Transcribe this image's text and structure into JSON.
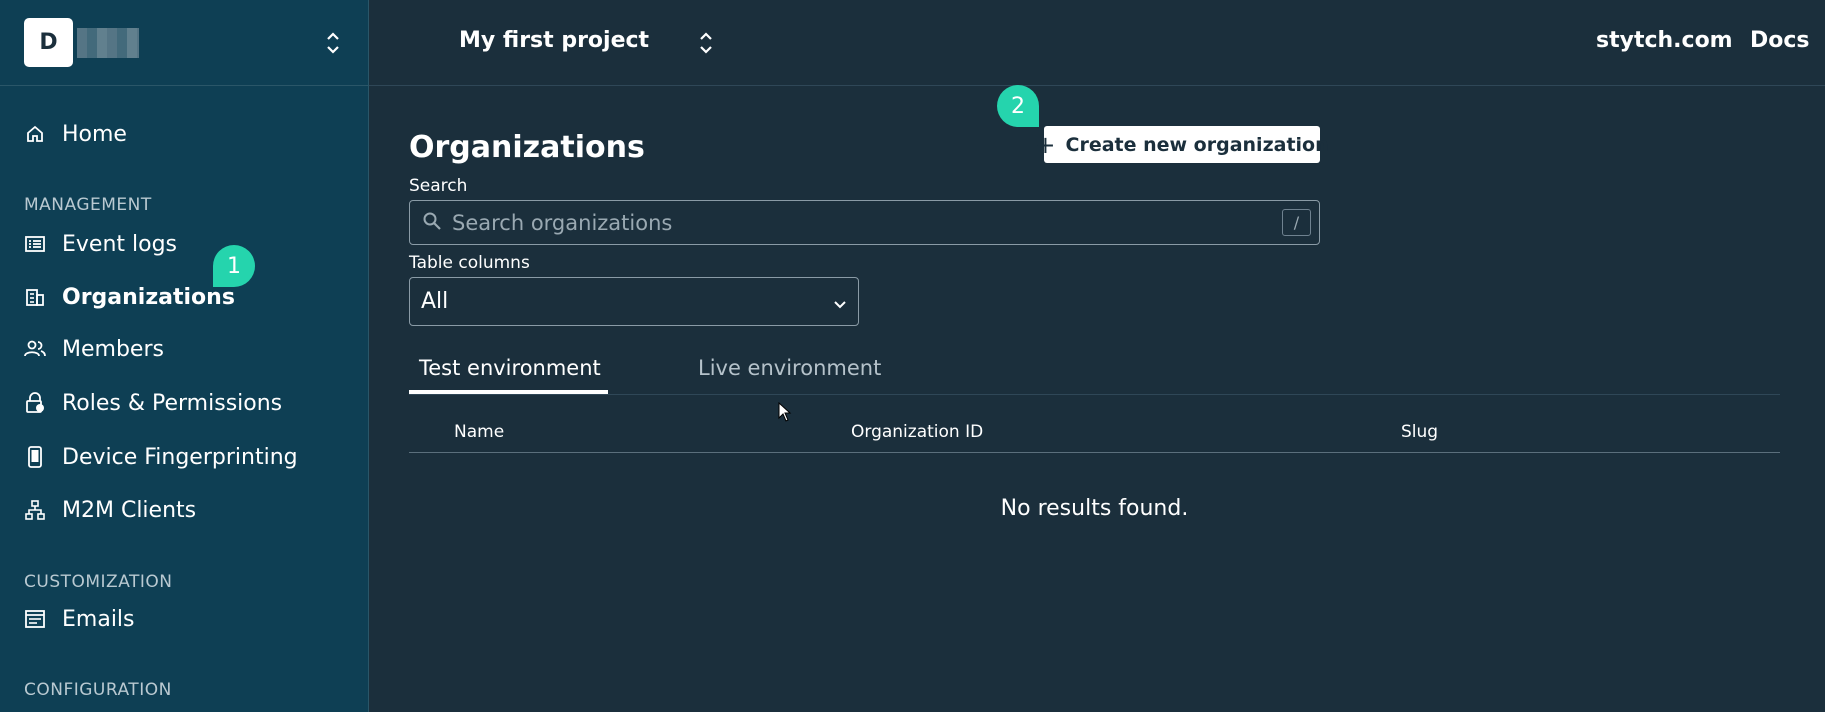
{
  "workspace": {
    "initial": "D"
  },
  "project": {
    "name": "My first project"
  },
  "top_links": {
    "site": "stytch.com",
    "docs": "Docs"
  },
  "sidebar": {
    "home": "Home",
    "sections": {
      "management": "MANAGEMENT",
      "customization": "CUSTOMIZATION",
      "configuration": "CONFIGURATION"
    },
    "items": {
      "event_logs": "Event logs",
      "organizations": "Organizations",
      "members": "Members",
      "roles": "Roles & Permissions",
      "device": "Device Fingerprinting",
      "m2m": "M2M Clients",
      "emails": "Emails"
    },
    "active": "organizations"
  },
  "badges": {
    "one": "1",
    "two": "2"
  },
  "page": {
    "title": "Organizations",
    "create_button": "Create new organization",
    "search_label": "Search",
    "search_placeholder": "Search organizations",
    "search_shortcut": "/",
    "columns_label": "Table columns",
    "columns_value": "All",
    "tabs": {
      "test": "Test environment",
      "live": "Live environment"
    },
    "active_tab": "test",
    "table_headers": {
      "name": "Name",
      "org_id": "Organization ID",
      "slug": "Slug"
    },
    "empty_message": "No results found."
  },
  "colors": {
    "sidebar_bg": "#0e3f54",
    "main_bg": "#1b2f3c",
    "badge": "#25d4ad"
  },
  "icons": {
    "home": "home-icon",
    "event_logs": "list-icon",
    "organizations": "building-icon",
    "members": "users-icon",
    "roles": "lock-icon",
    "device": "phone-icon",
    "m2m": "network-icon",
    "emails": "document-icon",
    "search": "search-icon"
  }
}
